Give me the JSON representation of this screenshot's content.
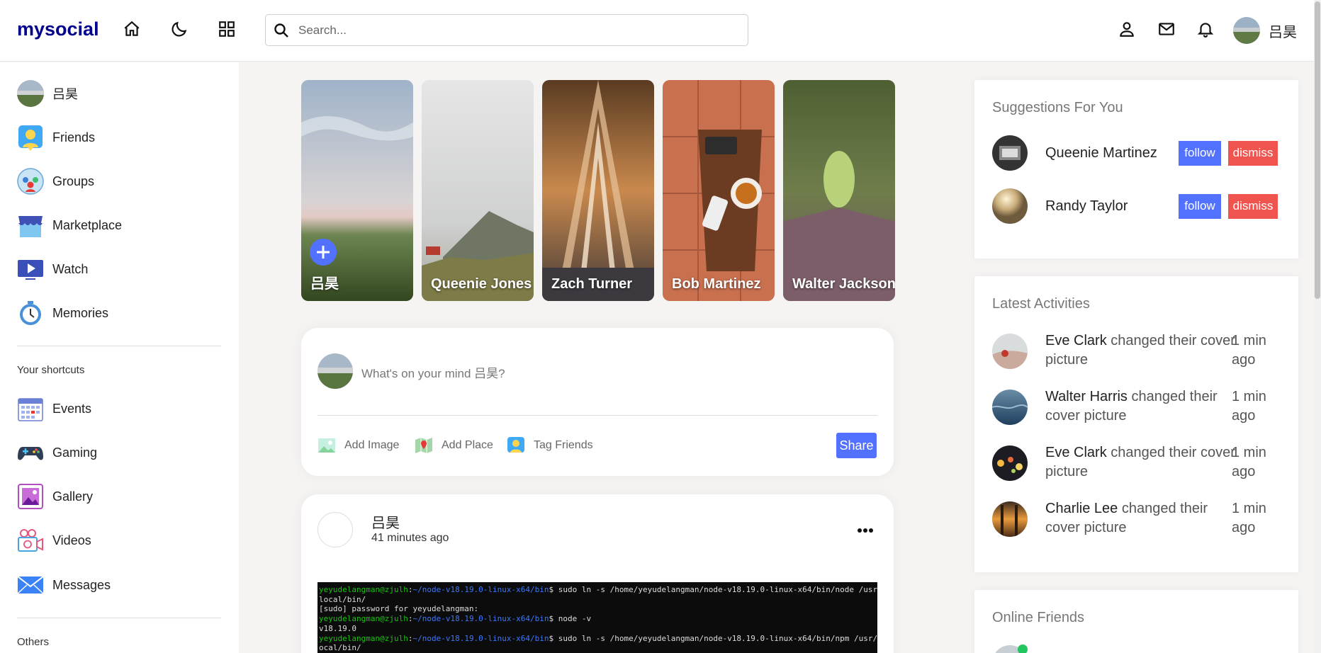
{
  "header": {
    "logo": "mysocial",
    "search_placeholder": "Search...",
    "user_name": "吕昊",
    "icons": [
      "home-icon",
      "moon-icon",
      "grid-icon",
      "search-icon",
      "user-icon",
      "mail-icon",
      "bell-icon"
    ]
  },
  "sidebar": {
    "items": [
      {
        "label": "吕昊",
        "icon": "avatar"
      },
      {
        "label": "Friends",
        "icon": "friends-icon"
      },
      {
        "label": "Groups",
        "icon": "groups-icon"
      },
      {
        "label": "Marketplace",
        "icon": "marketplace-icon"
      },
      {
        "label": "Watch",
        "icon": "watch-icon"
      },
      {
        "label": "Memories",
        "icon": "memories-icon"
      }
    ],
    "shortcuts_heading": "Your shortcuts",
    "shortcuts": [
      {
        "label": "Events",
        "icon": "events-icon"
      },
      {
        "label": "Gaming",
        "icon": "gaming-icon"
      },
      {
        "label": "Gallery",
        "icon": "gallery-icon"
      },
      {
        "label": "Videos",
        "icon": "videos-icon"
      },
      {
        "label": "Messages",
        "icon": "messages-icon"
      }
    ],
    "others_heading": "Others"
  },
  "stories": [
    {
      "name": "吕昊",
      "add": true
    },
    {
      "name": "Queenie Jones"
    },
    {
      "name": "Zach Turner"
    },
    {
      "name": "Bob Martinez"
    },
    {
      "name": "Walter Jackson"
    }
  ],
  "share": {
    "placeholder": "What's on your mind 吕昊?",
    "add_image": "Add Image",
    "add_place": "Add Place",
    "tag_friends": "Tag Friends",
    "button": "Share"
  },
  "post": {
    "author": "吕昊",
    "time": "41 minutes ago",
    "terminal": [
      {
        "prompt_user": "yeyudelangman@zjulh",
        "prompt_path": "~/node-v18.19.0-linux-x64/bin",
        "cmd": "$ sudo ln -s /home/yeyudelangman/node-v18.19.0-linux-x64/bin/node /usr/"
      },
      {
        "text": "local/bin/"
      },
      {
        "text": "[sudo] password for yeyudelangman:"
      },
      {
        "prompt_user": "yeyudelangman@zjulh",
        "prompt_path": "~/node-v18.19.0-linux-x64/bin",
        "cmd": "$ node -v"
      },
      {
        "text": "v18.19.0"
      },
      {
        "prompt_user": "yeyudelangman@zjulh",
        "prompt_path": "~/node-v18.19.0-linux-x64/bin",
        "cmd": "$ sudo ln -s /home/yeyudelangman/node-v18.19.0-linux-x64/bin/npm /usr/l"
      },
      {
        "text": "ocal/bin/"
      }
    ]
  },
  "suggestions": {
    "title": "Suggestions For You",
    "follow_label": "follow",
    "dismiss_label": "dismiss",
    "users": [
      {
        "name": "Queenie Martinez"
      },
      {
        "name": "Randy Taylor"
      }
    ]
  },
  "activities": {
    "title": "Latest Activities",
    "items": [
      {
        "name": "Eve Clark",
        "action": "changed their cover picture",
        "time": "1 min ago"
      },
      {
        "name": "Walter Harris",
        "action": "changed their cover picture",
        "time": "1 min ago"
      },
      {
        "name": "Eve Clark",
        "action": "changed their cover picture",
        "time": "1 min ago"
      },
      {
        "name": "Charlie Lee",
        "action": "changed their cover picture",
        "time": "1 min ago"
      }
    ]
  },
  "online": {
    "title": "Online Friends"
  },
  "colors": {
    "accent": "#5271ff",
    "dismiss": "#f0544f",
    "logo": "#00008b",
    "online": "#22c55e"
  }
}
